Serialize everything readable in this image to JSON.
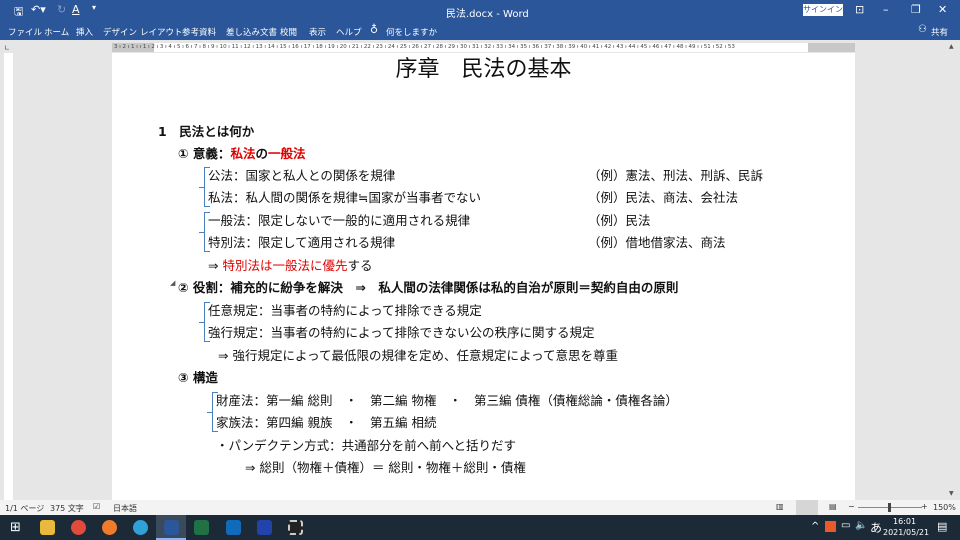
{
  "window": {
    "title": "民法.docx - Word",
    "signin": "サインイン",
    "share": "共有"
  },
  "ribbon": {
    "tabs": [
      "ファイル",
      "ホーム",
      "挿入",
      "デザイン",
      "レイアウト",
      "参考資料",
      "差し込み文書",
      "校閲",
      "表示",
      "ヘルプ"
    ],
    "tell_me": "何をしますか"
  },
  "ruler": {
    "marks": "3 ı 2 ı 1 ı  ı 1 ı 2 ı 3 ı 4 ı 5 ı 6 ı 7 ı 8 ı 9 ı 10 ı 11 ı 12 ı 13 ı 14 ı 15 ı 16 ı 17 ı 18 ı 19 ı 20 ı 21 ı 22 ı 23 ı 24 ı 25 ı 26 ı 27 ı 28 ı 29 ı 30 ı 31 ı 32 ı 33 ı 34 ı 35 ı 36 ı 37 ı 38 ı 39 ı 40 ı 41 ı 42 ı 43 ı 44 ı 45 ı 46 ı 47 ı 48 ı 49 ı  ı 51 ı 52 ı 53"
  },
  "document": {
    "title": "序章　民法の基本",
    "h1": "1　民法とは何か",
    "s1": {
      "num": "① 意義：",
      "red1": "私法",
      "mid": "の",
      "red2": "一般法"
    },
    "l1": {
      "text": "公法：国家と私人との関係を規律",
      "ex": "（例）憲法、刑法、刑訴、民訴"
    },
    "l2": {
      "text": "私法：私人間の関係を規律≒国家が当事者でない",
      "ex": "（例）民法、商法、会社法"
    },
    "l3": {
      "text": "一般法：限定しないで一般的に適用される規律",
      "ex": "（例）民法"
    },
    "l4": {
      "text": "特別法：限定して適用される規律",
      "ex": "（例）借地借家法、商法"
    },
    "l5": {
      "arrow": "⇒ ",
      "red": "特別法は一般法に優先",
      "tail": "する"
    },
    "s2": "② 役割：補充的に紛争を解決　⇒　私人間の法律関係は私的自治が原則＝契約自由の原則",
    "l6": "任意規定：当事者の特約によって排除できる規定",
    "l7": "強行規定：当事者の特約によって排除できない公の秩序に関する規定",
    "l8": "⇒ 強行規定によって最低限の規律を定め、任意規定によって意思を尊重",
    "s3": "③ 構造",
    "l9": "財産法：第一編 総則　・　第二編 物権　・　第三編 債権（債権総論・債権各論）",
    "l10": "家族法：第四編 親族　・　第五編 相続",
    "l11": "・パンデクテン方式：共通部分を前へ前へと括りだす",
    "l12": "⇒ 総則（物権＋債権）＝ 総則・物権＋総則・債権"
  },
  "status": {
    "page": "1/1 ページ",
    "words": "375 文字",
    "lang": "日本語",
    "zoom": "150%",
    "zoom_level": 150
  },
  "taskbar": {
    "time": "16:01",
    "date": "2021/05/21",
    "ime": "あ"
  },
  "colors": {
    "brand": "#2b579a",
    "red": "#e00000",
    "bracket": "#4a7fc0"
  }
}
